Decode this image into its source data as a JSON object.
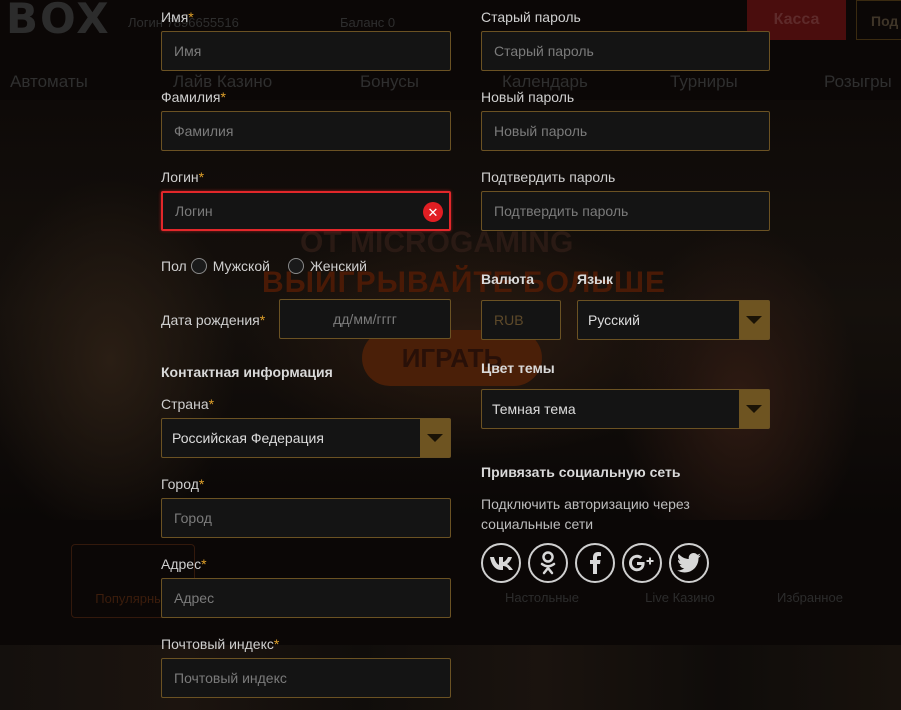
{
  "background": {
    "logo": "BOX",
    "login_text": "Логин 7896655516",
    "balance_text": "Баланс 0",
    "cashier_button": "Касса",
    "login_button": "Под",
    "nav": [
      "Автоматы",
      "Лайв Казино",
      "Бонусы",
      "Календарь",
      "Турниры",
      "Розыгры"
    ],
    "banner_line1": "OT MICROGAMING",
    "banner_line2": "ВЫИГРЫВАЙТЕ БОЛЬШЕ",
    "play_button": "ИГРАТЬ",
    "categories": [
      "Популярные",
      "Настольные",
      "Live Казино",
      "Избранное"
    ]
  },
  "form": {
    "first_name": {
      "label": "Имя",
      "placeholder": "Имя"
    },
    "last_name": {
      "label": "Фамилия",
      "placeholder": "Фамилия"
    },
    "login": {
      "label": "Логин",
      "placeholder": "Логин",
      "error_icon": "close-circle-icon"
    },
    "gender": {
      "label": "Пол",
      "options": [
        "Мужской",
        "Женский"
      ]
    },
    "birth_date": {
      "label": "Дата рождения",
      "placeholder": "дд/мм/гггг"
    },
    "contact_title": "Контактная информация",
    "country": {
      "label": "Страна",
      "value": "Российская Федерация"
    },
    "city": {
      "label": "Город",
      "placeholder": "Город"
    },
    "address": {
      "label": "Адрес",
      "placeholder": "Адрес"
    },
    "postal": {
      "label": "Почтовый индекс",
      "placeholder": "Почтовый индекс"
    },
    "old_password": {
      "label": "Старый пароль",
      "placeholder": "Старый пароль"
    },
    "new_password": {
      "label": "Новый пароль",
      "placeholder": "Новый пароль"
    },
    "confirm_password": {
      "label": "Подтвердить пароль",
      "placeholder": "Подтвердить пароль"
    },
    "currency": {
      "label": "Валюта",
      "placeholder": "RUB"
    },
    "language": {
      "label": "Язык",
      "value": "Русский"
    },
    "theme": {
      "label": "Цвет темы",
      "value": "Темная тема"
    },
    "social": {
      "title": "Привязать социальную сеть",
      "description": "Подключить авторизацию через социальные сети",
      "networks": [
        {
          "icon": "vk-icon",
          "glyph": "vk"
        },
        {
          "icon": "odnoklassniki-icon",
          "glyph": "ok"
        },
        {
          "icon": "facebook-icon",
          "glyph": "f"
        },
        {
          "icon": "google-plus-icon",
          "glyph": "G+"
        },
        {
          "icon": "twitter-icon",
          "glyph": "t"
        }
      ]
    },
    "required_mark": "*"
  },
  "colors": {
    "accent": "#6e5421",
    "required": "#e0a12a",
    "error": "#e2272a"
  }
}
